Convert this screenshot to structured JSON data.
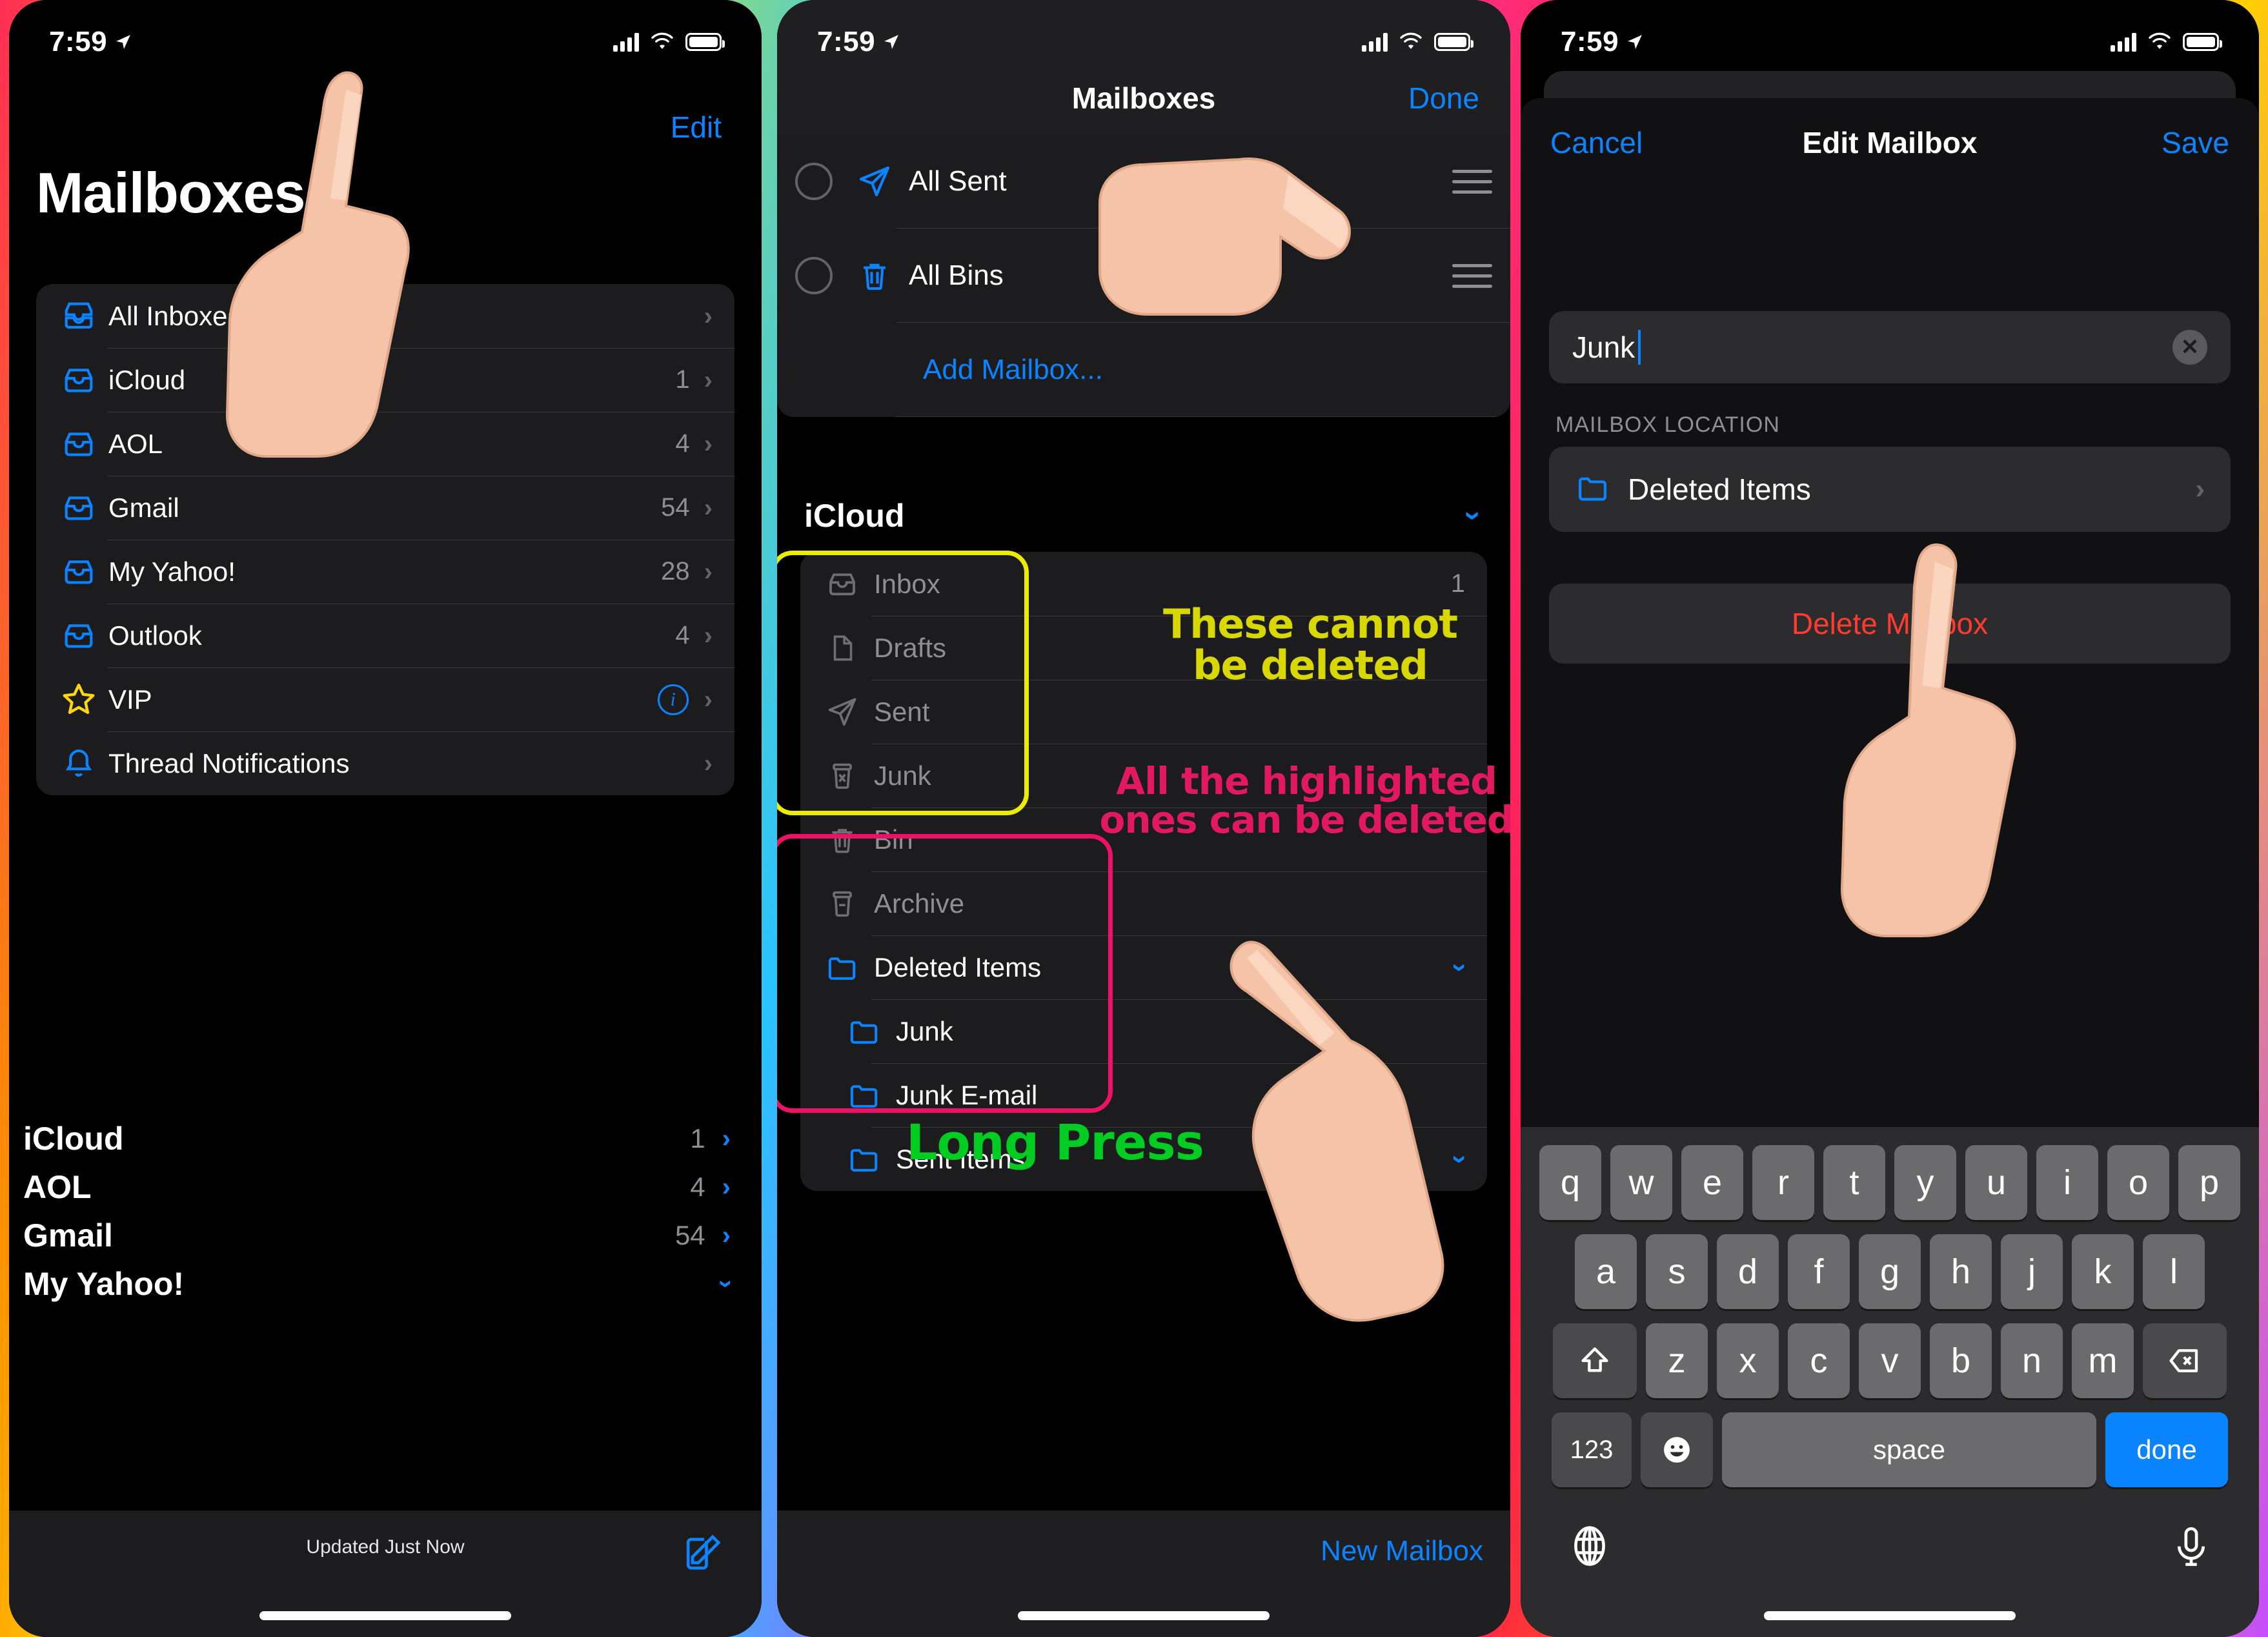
{
  "status_bar": {
    "time": "7:59",
    "location_icon": "location-arrow-icon",
    "signal_icon": "cellular-signal-icon",
    "wifi_icon": "wifi-icon",
    "battery_icon": "battery-icon"
  },
  "panel1": {
    "edit_label": "Edit",
    "title": "Mailboxes",
    "mailboxes": [
      {
        "label": "All Inboxes",
        "count": "",
        "icon": "all-inboxes-icon"
      },
      {
        "label": "iCloud",
        "count": "1",
        "icon": "inbox-icon"
      },
      {
        "label": "AOL",
        "count": "4",
        "icon": "inbox-icon"
      },
      {
        "label": "Gmail",
        "count": "54",
        "icon": "inbox-icon"
      },
      {
        "label": "My Yahoo!",
        "count": "28",
        "icon": "inbox-icon"
      },
      {
        "label": "Outlook",
        "count": "4",
        "icon": "inbox-icon"
      },
      {
        "label": "VIP",
        "count": "",
        "icon": "star-icon"
      },
      {
        "label": "Thread Notifications",
        "count": "",
        "icon": "bell-icon"
      }
    ],
    "accounts": [
      {
        "label": "iCloud",
        "count": "1"
      },
      {
        "label": "AOL",
        "count": "4"
      },
      {
        "label": "Gmail",
        "count": "54"
      },
      {
        "label": "My Yahoo!",
        "count": ""
      }
    ],
    "toolbar": {
      "updated": "Updated Just Now",
      "compose_icon": "compose-icon"
    }
  },
  "panel2": {
    "nav": {
      "title": "Mailboxes",
      "done_label": "Done"
    },
    "edit_rows": [
      {
        "label": "All Sent",
        "icon": "paper-plane-icon"
      },
      {
        "label": "All Bins",
        "icon": "trash-icon"
      }
    ],
    "add_mailbox_label": "Add Mailbox...",
    "account_header": "iCloud",
    "system_folders": [
      {
        "label": "Inbox",
        "count": "1",
        "icon": "inbox-icon"
      },
      {
        "label": "Drafts",
        "count": "",
        "icon": "draft-icon"
      },
      {
        "label": "Sent",
        "count": "",
        "icon": "paper-plane-icon"
      },
      {
        "label": "Junk",
        "count": "",
        "icon": "junk-icon"
      },
      {
        "label": "Bin",
        "count": "",
        "icon": "trash-icon"
      },
      {
        "label": "Archive",
        "count": "",
        "icon": "archive-icon"
      }
    ],
    "custom_folders": [
      {
        "label": "Deleted Items",
        "icon": "folder-icon",
        "chevron": "chevron-down-icon"
      },
      {
        "label": "Junk",
        "icon": "folder-icon",
        "chevron": ""
      },
      {
        "label": "Junk E-mail",
        "icon": "folder-icon",
        "chevron": ""
      },
      {
        "label": "Sent Items",
        "icon": "folder-icon",
        "chevron": "chevron-down-icon"
      }
    ],
    "annotations": {
      "cannot_delete": "These cannot be deleted",
      "can_delete": "All the highlighted ones can be deleted",
      "long_press": "Long Press"
    },
    "new_mailbox_label": "New Mailbox",
    "highlight_colors": {
      "yellow": "#ecec00",
      "pink": "#ed1265",
      "green": "#00cc22"
    }
  },
  "panel3": {
    "nav": {
      "cancel_label": "Cancel",
      "title": "Edit Mailbox",
      "save_label": "Save"
    },
    "name_field": {
      "value": "Junk",
      "clear_icon": "clear-circle-icon"
    },
    "section_label": "MAILBOX LOCATION",
    "location": {
      "label": "Deleted Items",
      "icon": "folder-icon"
    },
    "delete_label": "Delete Mailbox",
    "delete_color": "#ff3b30",
    "keyboard": {
      "row1": [
        "q",
        "w",
        "e",
        "r",
        "t",
        "y",
        "u",
        "i",
        "o",
        "p"
      ],
      "row2": [
        "a",
        "s",
        "d",
        "f",
        "g",
        "h",
        "j",
        "k",
        "l"
      ],
      "row3_shift": "shift-icon",
      "row3": [
        "z",
        "x",
        "c",
        "v",
        "b",
        "n",
        "m"
      ],
      "row3_backspace": "backspace-icon",
      "numbers_label": "123",
      "emoji_icon": "emoji-icon",
      "space_label": "space",
      "done_label": "done",
      "globe_icon": "globe-icon",
      "mic_icon": "microphone-icon"
    }
  }
}
